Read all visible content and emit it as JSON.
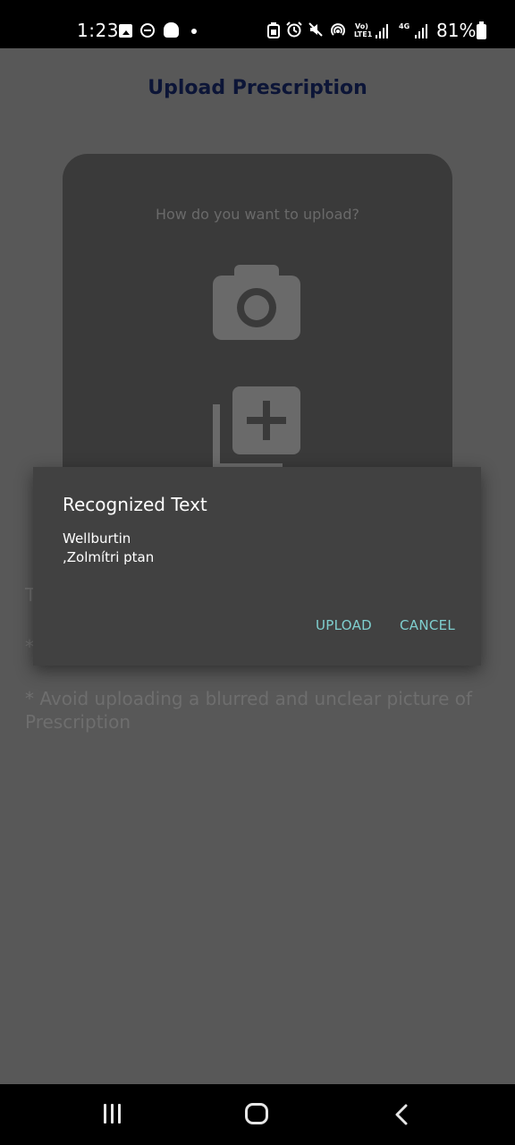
{
  "status_bar": {
    "time": "1:23",
    "network_volte": "Vo)",
    "network_lte": "LTE1",
    "network_4g": "4G",
    "battery": "81%",
    "icons": [
      "gallery-icon",
      "dnd-icon",
      "snapchat-icon",
      "dot-icon",
      "battery-saver-icon",
      "alarm-icon",
      "mute-icon",
      "hotspot-icon",
      "signal-icon",
      "signal-icon",
      "battery-icon"
    ]
  },
  "page": {
    "title": "Upload Prescription",
    "upload_question": "How do you want to upload?",
    "hint_partial_1": "T",
    "hint_partial_2": "*",
    "hint_blur": "* Avoid uploading a blurred and unclear picture of Prescription"
  },
  "dialog": {
    "title": "Recognized Text",
    "lines": [
      "Wellburtin",
      ",Zolmítri ptan"
    ],
    "upload_label": "UPLOAD",
    "cancel_label": "CANCEL"
  },
  "colors": {
    "scrim_background": "#585858",
    "title_color": "#0c1537",
    "card_background": "#3a3a3a",
    "dialog_background": "#414141",
    "dialog_button": "#7fcfcf"
  }
}
